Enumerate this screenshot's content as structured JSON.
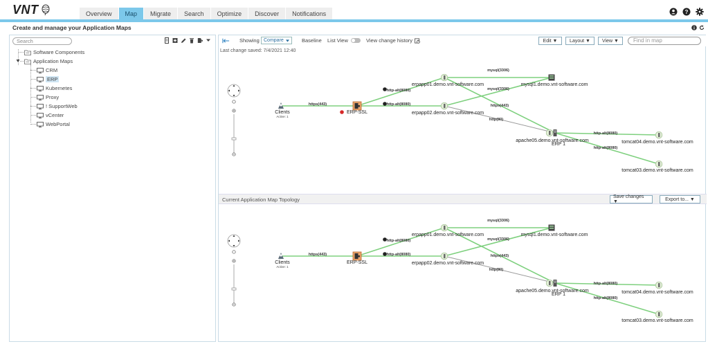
{
  "app": {
    "logo_text": "VNT",
    "nav_tabs": [
      {
        "label": "Overview"
      },
      {
        "label": "Map"
      },
      {
        "label": "Migrate"
      },
      {
        "label": "Search"
      },
      {
        "label": "Optimize"
      },
      {
        "label": "Discover"
      },
      {
        "label": "Notifications"
      }
    ],
    "active_tab": "Map",
    "accent_color": "#7cc8ea",
    "header_icons": [
      "user-icon",
      "help-icon",
      "gear-icon"
    ]
  },
  "page": {
    "title": "Create and manage your Application Maps",
    "title_icons": [
      "info-icon",
      "refresh-icon"
    ]
  },
  "left_panel": {
    "search_placeholder": "Search",
    "tools": [
      "server-icon",
      "add-icon",
      "edit-icon",
      "delete-icon",
      "export-icon",
      "dropdown-icon"
    ],
    "tree": [
      {
        "label": "Software Components",
        "icon": "folder-icon",
        "level": 0
      },
      {
        "label": "Application Maps",
        "icon": "folder-icon",
        "level": 0
      },
      {
        "label": "CRM",
        "icon": "monitor-icon",
        "level": 1
      },
      {
        "label": "ERP",
        "icon": "monitor-icon",
        "level": 1,
        "selected": true
      },
      {
        "label": "Kubernetes",
        "icon": "monitor-icon",
        "level": 1
      },
      {
        "label": "Proxy",
        "icon": "monitor-icon",
        "level": 1
      },
      {
        "label": "! SupportWeb",
        "icon": "monitor-icon",
        "level": 1
      },
      {
        "label": "vCenter",
        "icon": "monitor-icon",
        "level": 1
      },
      {
        "label": "WebPortal",
        "icon": "monitor-icon",
        "level": 1
      }
    ]
  },
  "toolbar": {
    "showing_label": "Showing",
    "showing_value": "Compare",
    "baseline_label": "Baseline",
    "list_view_label": "List View",
    "list_view_on": false,
    "history_label": "View change history",
    "edit_label": "Edit ▼",
    "layout_label": "Layout ▼",
    "view_label": "View ▼",
    "find_placeholder": "Find in map"
  },
  "last_saved": "Last change saved: 7/4/2021 12:40",
  "lower_section": {
    "title": "Current Application Map Topology",
    "save_label": "Save changes ▼",
    "export_label": "Export to... ▼"
  },
  "map": {
    "nodes": [
      {
        "id": "clients",
        "label": "Clients",
        "sub": "Active: 1",
        "icon": "clients-icon"
      },
      {
        "id": "erpssl",
        "label": "ERP-SSL",
        "icon": "load-balancer-icon"
      },
      {
        "id": "app1",
        "label": "erpapp01.demo.vnt-software.com",
        "icon": "server-node-icon"
      },
      {
        "id": "app2",
        "label": "erpapp02.demo.vnt-software.com",
        "icon": "server-node-icon"
      },
      {
        "id": "mysql",
        "label": "mysql1.demo.vnt-software.com",
        "icon": "database-icon"
      },
      {
        "id": "apache",
        "label": "apache05.demo.vnt-software.com",
        "icon": "server-node-icon"
      },
      {
        "id": "erp1",
        "label": "ERP 1",
        "icon": "server-tower-icon"
      },
      {
        "id": "tomcat4",
        "label": "tomcat04.demo.vnt-software.com",
        "icon": "server-node-icon"
      },
      {
        "id": "tomcat3",
        "label": "tomcat03.demo.vnt-software.com",
        "icon": "server-node-icon"
      }
    ],
    "edges": [
      {
        "from": "clients",
        "to": "erpssl",
        "label": "https(443)"
      },
      {
        "from": "erpssl",
        "to": "app1",
        "label": "http-alt(8080)"
      },
      {
        "from": "erpssl",
        "to": "app2",
        "label": "http-alt(8080)"
      },
      {
        "from": "app1",
        "to": "mysql",
        "label": "mysql(3306)"
      },
      {
        "from": "app2",
        "to": "mysql",
        "label": "mysql(3306)"
      },
      {
        "from": "app1",
        "to": "erp1",
        "label": "https(443)"
      },
      {
        "from": "app2",
        "to": "erp1",
        "label": "http(80)"
      },
      {
        "from": "erp1",
        "to": "tomcat4",
        "label": "http-alt(8080)"
      },
      {
        "from": "erp1",
        "to": "tomcat3",
        "label": "http-alt(8080)"
      }
    ],
    "status_dot_color": "#d62828",
    "edge_color": "#7ed07e",
    "edge_color_removed": "#9a9a9a"
  }
}
